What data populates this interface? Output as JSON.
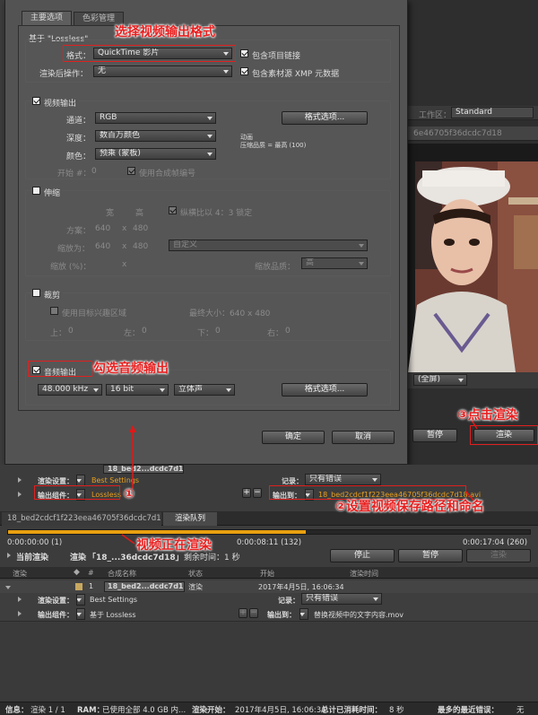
{
  "dialog": {
    "tabs": [
      "主要选项",
      "色彩管理"
    ],
    "based_on": "基于 \"Lossless\"",
    "format_label": "格式：",
    "format_value": "QuickTime 影片",
    "include_project_link": "包含项目链接",
    "post_render_label": "渲染后操作：",
    "post_render_value": "无",
    "include_xmp": "包含素材源 XMP 元数据",
    "video_output": "视频输出",
    "channel_label": "通道：",
    "channel_value": "RGB",
    "format_options": "格式选项...",
    "depth_label": "深度：",
    "depth_value": "数百万颜色",
    "info_line1": "动画",
    "info_line2": "压缩品质 = 最高 (100)",
    "color_label": "颜色：",
    "color_value": "预乘 (蒙板)",
    "start_label": "开始 #：",
    "start_value": "0",
    "use_comp_frame": "使用合成帧编号",
    "stretch": "伸缩",
    "width_col": "宽",
    "height_col": "高",
    "lock_aspect": "纵横比以 4：3 锁定",
    "dims_label": "方案：",
    "dims_w": "640",
    "dims_x": "x",
    "dims_h": "480",
    "scale_to_label": "缩放为：",
    "scale_w": "640",
    "scale_x": "x",
    "scale_h": "480",
    "custom": "自定义",
    "scale_pct_label": "缩放 (%)：",
    "scale_pct_x": "x",
    "scale_quality_label": "缩放品质：",
    "scale_quality_value": "高",
    "crop": "裁剪",
    "use_roi": "使用目标兴趣区域",
    "max_size": "最终大小：640 x 480",
    "top_label": "上：",
    "top_val": "0",
    "left_label": "左：",
    "left_val": "0",
    "bottom_label": "下：",
    "bottom_val": "0",
    "right_label": "右：",
    "right_val": "0",
    "audio_output": "音频输出",
    "sample_rate": "48.000 kHz",
    "bit_depth": "16 bit",
    "channels": "立体声",
    "audio_format_options": "格式选项...",
    "ok": "确定",
    "cancel": "取消"
  },
  "right_panel": {
    "workspace_label": "工作区：",
    "workspace_value": "Standard",
    "comp_tab": "6e46705f36dcdc7d18",
    "zoom_value": "(全屏)",
    "pause": "暂停",
    "render": "渲染"
  },
  "queue_upper": {
    "comp_name": "18_bed2...dcdc7d18",
    "render_settings_label": "渲染设置：",
    "render_settings_value": "Best Settings",
    "log_label": "记录：",
    "log_value": "只有错误",
    "output_module_label": "输出组件：",
    "output_module_value": "Lossless",
    "output_to_label": "输出到：",
    "output_to_value": "18_bed2cdcf1f223eea46705f36dcdc7d18.avi"
  },
  "tabs": [
    "18_bed2cdcf1f223eea46705f36dcdc7d18",
    "渲染队列"
  ],
  "progress": {
    "fraction": 0.57,
    "start_time": "0:00:00:00 (1)",
    "current_time": "0:00:08:11 (132)",
    "end_time": "0:00:17:04 (260)",
    "current_render_label": "当前渲染",
    "rendering_label": "渲染",
    "rendering_item": "「18_...36dcdc7d18」",
    "remaining": "剩余时间：1 秒",
    "stop": "停止",
    "pause": "暂停",
    "render": "渲染"
  },
  "table": {
    "headers": [
      "渲染",
      "#",
      "合成名称",
      "状态",
      "开始",
      "渲染时间"
    ],
    "row": {
      "num": "1",
      "name": "18_bed2...dcdc7d18",
      "status": "渲染",
      "start": "2017年4月5日, 16:06:34"
    },
    "render_settings_label": "渲染设置：",
    "render_settings_value": "Best Settings",
    "log_label": "记录：",
    "log_value": "只有错误",
    "output_module_label": "输出组件：",
    "output_module_value": "基于 Lossless",
    "output_to_label": "输出到：",
    "output_to_value": "替换视频中的文字内容.mov"
  },
  "status_bar": {
    "info_label": "信息：",
    "info_value": "渲染 1 / 1",
    "ram_label": "RAM：",
    "ram_value": "已使用全部 4.0 GB 内...",
    "render_start_label": "渲染开始：",
    "render_start_value": "2017年4月5日, 16:06:34",
    "total_time_label": "总计已消耗时间：",
    "total_time_value": "8 秒",
    "last_error_label": "最多的最近错误：",
    "last_error_value": "无"
  },
  "annotations": {
    "choose_format": "选择视频输出格式",
    "check_audio": "勾选音频输出",
    "click_render": "③点击渲染",
    "circle_one": "①",
    "set_path": "②设置视频保存路径和命名",
    "rendering": "视频正在渲染"
  },
  "colors": {
    "annotation_red": "#e01818",
    "progress_orange": "#e8a010",
    "output_path_orange": "#e8a020"
  }
}
